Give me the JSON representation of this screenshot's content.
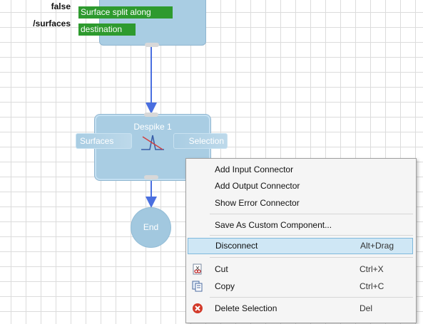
{
  "top_node": {
    "param_labels": [
      "false",
      "/surfaces"
    ],
    "fields": [
      "Surface split along",
      "destination"
    ]
  },
  "despike_node": {
    "title": "Despike 1",
    "input_port": "Surfaces",
    "output_port": "Selection",
    "icon": "despike-curve-icon"
  },
  "end_node": {
    "label": "End"
  },
  "colors": {
    "node": "#a9cde3",
    "arrow": "#4a6fe0",
    "field_green": "#2e9a2e",
    "menu_highlight": "#cfe7f5"
  },
  "context_menu": {
    "items": [
      {
        "label": "Add Input Connector",
        "shortcut": ""
      },
      {
        "label": "Add Output Connector",
        "shortcut": ""
      },
      {
        "label": "Show Error Connector",
        "shortcut": ""
      },
      {
        "label": "Save As Custom Component...",
        "shortcut": ""
      },
      {
        "label": "Disconnect",
        "shortcut": "Alt+Drag"
      },
      {
        "label": "Cut",
        "shortcut": "Ctrl+X",
        "icon": "cut-icon"
      },
      {
        "label": "Copy",
        "shortcut": "Ctrl+C",
        "icon": "copy-icon"
      },
      {
        "label": "Delete Selection",
        "shortcut": "Del",
        "icon": "delete-icon"
      }
    ]
  }
}
